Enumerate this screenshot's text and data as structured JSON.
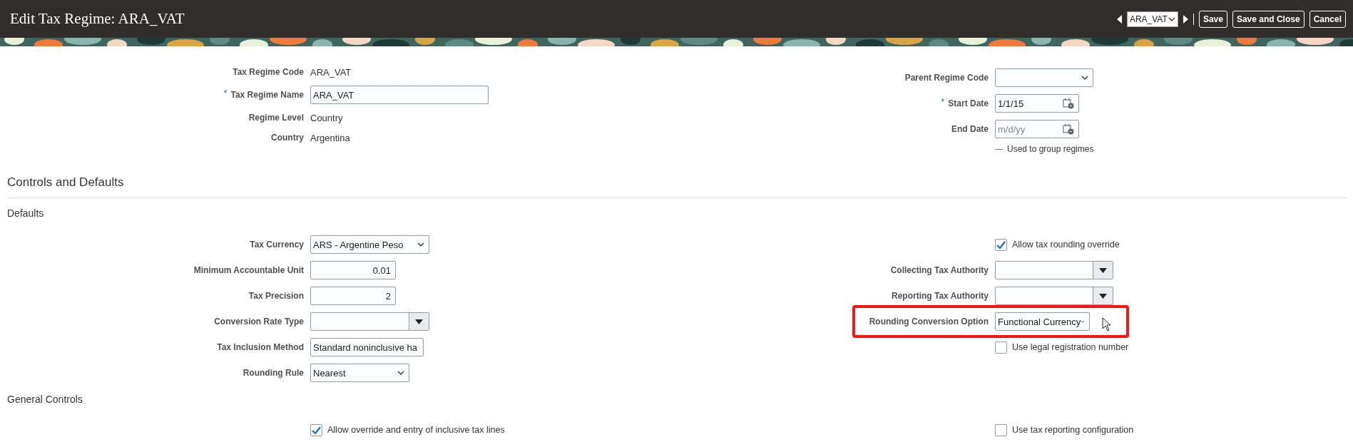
{
  "header": {
    "title": "Edit Tax Regime: ARA_VAT",
    "record_select": {
      "value": "ARA_VAT"
    },
    "buttons": [
      "Save",
      "Save and Close",
      "Cancel"
    ]
  },
  "general": {
    "left": [
      {
        "kind": "text",
        "label": "Tax Regime Code",
        "value": "ARA_VAT"
      },
      {
        "kind": "input",
        "label": "Tax Regime Name",
        "value": "ARA_VAT",
        "required_mark": "*"
      },
      {
        "kind": "text",
        "label": "Regime Level",
        "value": "Country"
      },
      {
        "kind": "text",
        "label": "Country",
        "value": "Argentina"
      }
    ],
    "right": [
      {
        "kind": "select",
        "label": "Parent Regime Code"
      },
      {
        "kind": "date",
        "label": "Start Date",
        "value": "1/1/15",
        "required_mark": "*"
      },
      {
        "kind": "date",
        "label": "End Date",
        "placeholder": "m/d/yy"
      },
      {
        "kind": "note",
        "value": "Used to group regimes"
      }
    ]
  },
  "controls_title": "Controls and Defaults",
  "defaults": {
    "title": "Defaults",
    "left": [
      {
        "kind": "select",
        "label": "Tax Currency",
        "value": "ARS - Argentine Peso"
      },
      {
        "kind": "number",
        "label": "Minimum Accountable Unit",
        "value": "0.01"
      },
      {
        "kind": "number",
        "label": "Tax Precision",
        "value": "2"
      },
      {
        "kind": "lov",
        "label": "Conversion Rate Type"
      },
      {
        "kind": "select",
        "label": "Tax Inclusion Method",
        "value": "Standard noninclusive ha"
      },
      {
        "kind": "select",
        "label": "Rounding Rule",
        "value": "Nearest"
      }
    ],
    "right": [
      {
        "kind": "checkbox",
        "value": "Allow tax rounding override",
        "checked": true
      },
      {
        "kind": "lov",
        "label": "Collecting Tax Authority",
        "highlighted": false
      },
      {
        "kind": "lov",
        "label": "Reporting Tax Authority",
        "highlighted": false
      },
      {
        "kind": "select",
        "label": "Rounding Conversion Option",
        "value": "Functional Currency",
        "highlighted": true
      },
      {
        "kind": "checkbox",
        "value": "Use legal registration number",
        "checked": false
      }
    ]
  },
  "general_controls": {
    "title": "General Controls",
    "left": [
      {
        "kind": "checkbox",
        "value": "Allow override and entry of inclusive tax lines",
        "checked": true
      }
    ],
    "right": [
      {
        "kind": "checkbox",
        "value": "Use tax reporting configuration",
        "checked": false
      }
    ]
  }
}
